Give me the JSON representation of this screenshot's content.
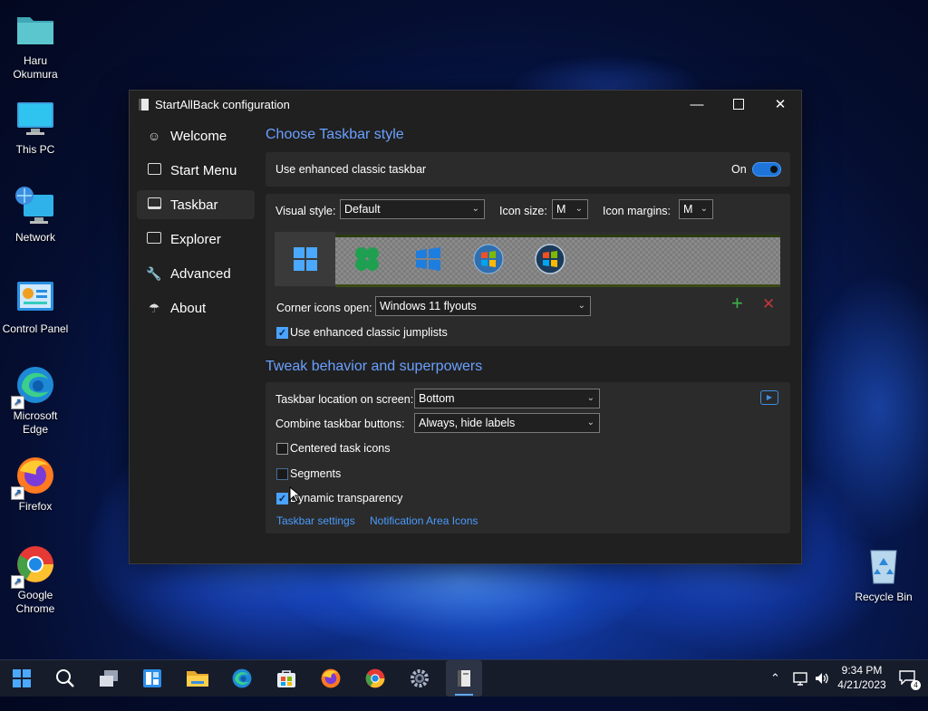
{
  "desktop": {
    "icons": [
      {
        "label": "Haru\nOkumura",
        "icon": "folder-icon"
      },
      {
        "label": "This PC",
        "icon": "monitor-icon"
      },
      {
        "label": "Network",
        "icon": "network-icon"
      },
      {
        "label": "Control Panel",
        "icon": "control-panel-icon"
      },
      {
        "label": "Microsoft\nEdge",
        "icon": "edge-icon"
      },
      {
        "label": "Firefox",
        "icon": "firefox-icon"
      },
      {
        "label": "Google\nChrome",
        "icon": "chrome-icon"
      },
      {
        "label": "Recycle Bin",
        "icon": "recycle-bin-icon"
      }
    ]
  },
  "window": {
    "title": "StartAllBack configuration",
    "nav": [
      {
        "label": "Welcome",
        "icon": "smiley-icon",
        "selected": false
      },
      {
        "label": "Start Menu",
        "icon": "start-menu-icon",
        "selected": false
      },
      {
        "label": "Taskbar",
        "icon": "taskbar-icon",
        "selected": true
      },
      {
        "label": "Explorer",
        "icon": "folder-icon",
        "selected": false
      },
      {
        "label": "Advanced",
        "icon": "wrench-icon",
        "selected": false
      },
      {
        "label": "About",
        "icon": "info-icon",
        "selected": false
      }
    ],
    "style_section": {
      "heading": "Choose Taskbar style",
      "enhanced_label": "Use enhanced classic taskbar",
      "toggle_state": "On",
      "visual_style_label": "Visual style:",
      "visual_style_value": "Default",
      "icon_size_label": "Icon size:",
      "icon_size_value": "M",
      "icon_margins_label": "Icon margins:",
      "icon_margins_value": "M",
      "corner_label": "Corner icons open:",
      "corner_value": "Windows 11 flyouts",
      "jumplists_label": "Use enhanced classic jumplists",
      "jumplists_checked": true
    },
    "tweak_section": {
      "heading": "Tweak behavior and superpowers",
      "location_label": "Taskbar location on screen:",
      "location_value": "Bottom",
      "combine_label": "Combine taskbar buttons:",
      "combine_value": "Always, hide labels",
      "centered_label": "Centered task icons",
      "centered_checked": false,
      "segments_label": "Segments",
      "segments_checked": false,
      "dynamic_label": "Dynamic transparency",
      "dynamic_checked": true,
      "link_taskbar_settings": "Taskbar settings",
      "link_notification_icons": "Notification Area Icons"
    }
  },
  "taskbar": {
    "clock_time": "9:34 PM",
    "clock_date": "4/21/2023",
    "notification_count": "4"
  }
}
